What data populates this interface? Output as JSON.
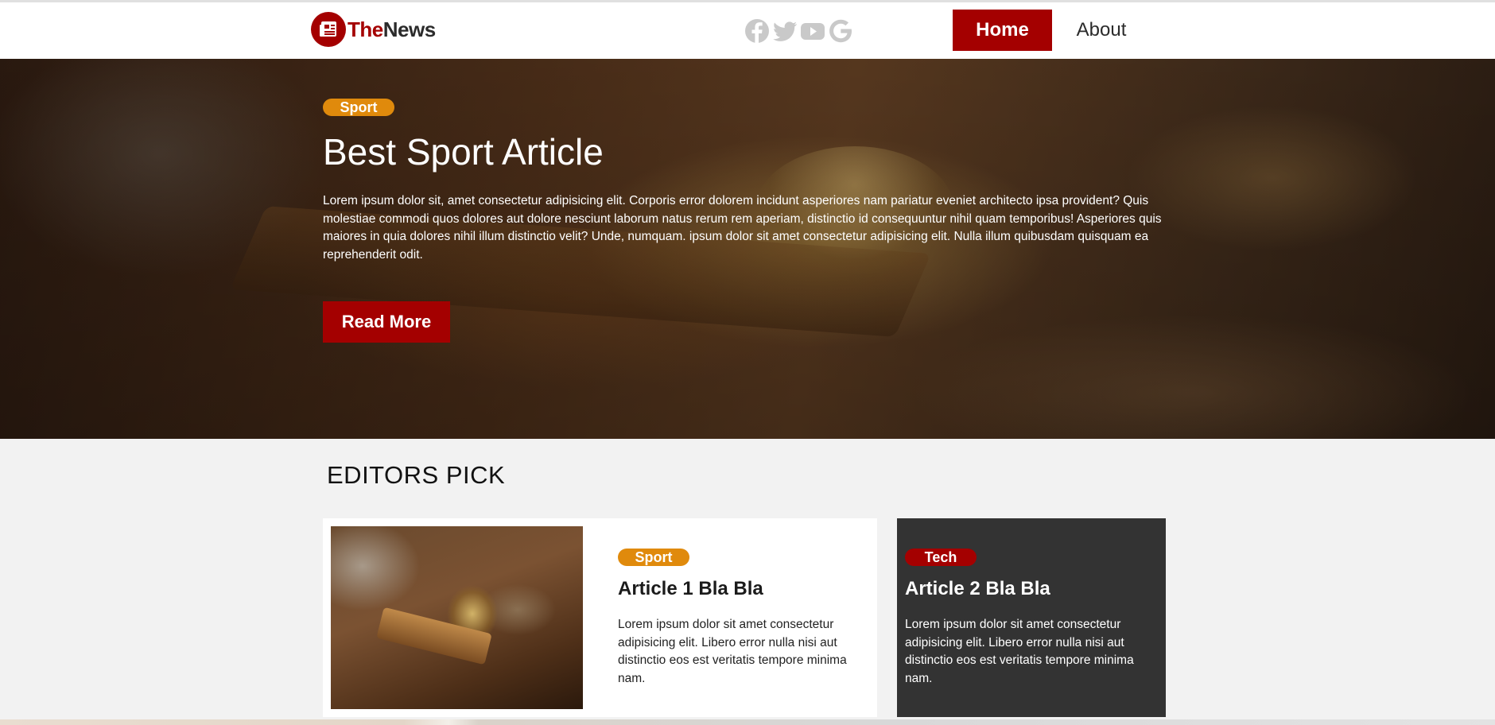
{
  "brand": {
    "part1": "The",
    "part2": "News",
    "accent_color": "#a40000"
  },
  "socials": [
    {
      "icon": "facebook-icon"
    },
    {
      "icon": "twitter-icon"
    },
    {
      "icon": "youtube-icon"
    },
    {
      "icon": "google-icon"
    }
  ],
  "nav": {
    "home": "Home",
    "about": "About",
    "active": "Home"
  },
  "hero": {
    "badge": "Sport",
    "badge_color": "#e08a0c",
    "title": "Best Sport Article",
    "body": "Lorem ipsum dolor sit, amet consectetur adipisicing elit. Corporis error dolorem incidunt asperiores nam pariatur eveniet architecto ipsa provident? Quis molestiae commodi quos dolores aut dolore nesciunt laborum natus rerum rem aperiam, distinctio id consequuntur nihil quam temporibus! Asperiores quis maiores in quia dolores nihil illum distinctio velit? Unde, numquam. ipsum dolor sit amet consectetur adipisicing elit. Nulla illum quibusdam quisquam ea reprehenderit odit.",
    "button": "Read More"
  },
  "editors_pick": {
    "title": "EDITORS PICK",
    "cards": [
      {
        "badge": "Sport",
        "badge_color": "#e08a0c",
        "title": "Article 1 Bla Bla",
        "body": "Lorem ipsum dolor sit amet consectetur adipisicing elit. Libero error nulla nisi aut distinctio eos est veritatis tempore minima nam."
      },
      {
        "badge": "Tech",
        "badge_color": "#a40000",
        "title": "Article 2 Bla Bla",
        "body": "Lorem ipsum dolor sit amet consectetur adipisicing elit. Libero error nulla nisi aut distinctio eos est veritatis tempore minima nam."
      }
    ]
  }
}
